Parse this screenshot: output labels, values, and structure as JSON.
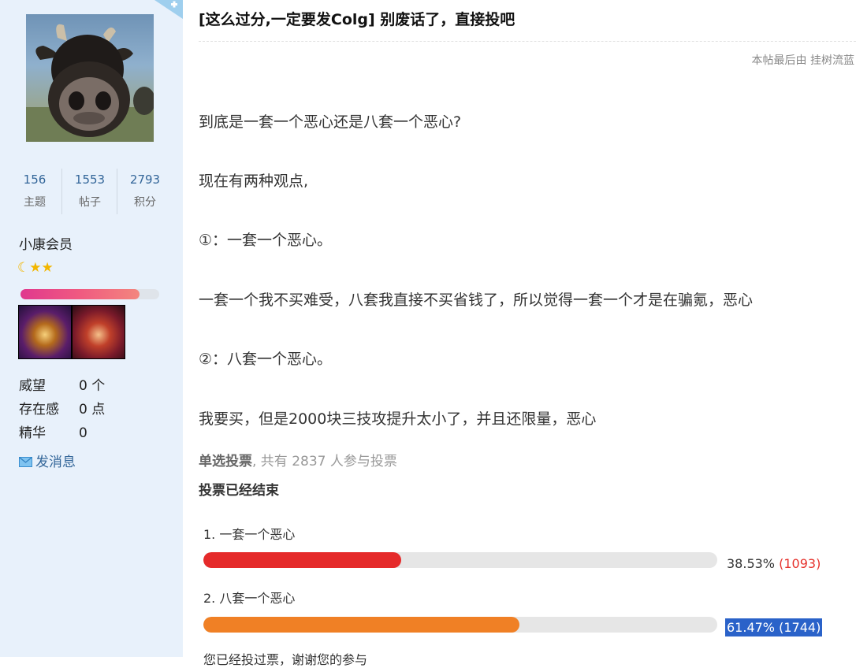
{
  "profile": {
    "stats": [
      {
        "value": "156",
        "label": "主题"
      },
      {
        "value": "1553",
        "label": "帖子"
      },
      {
        "value": "2793",
        "label": "积分"
      }
    ],
    "group": "小康会员",
    "rank_icons": [
      "moon-icon",
      "star-icon",
      "star-icon"
    ],
    "rank_progress": 0.86,
    "info": [
      {
        "key": "威望",
        "value": "0 个"
      },
      {
        "key": "存在感",
        "value": "0 点"
      },
      {
        "key": "精华",
        "value": "0"
      }
    ],
    "send_message": "发消息"
  },
  "post": {
    "title": "[这么过分,一定要发Colg] 别废话了，直接投吧",
    "last_edit": "本帖最后由 挂树流蓝",
    "paragraphs": [
      "到底是一套一个恶心还是八套一个恶心?",
      "现在有两种观点,",
      "①：一套一个恶心。",
      "一套一个我不买难受，八套我直接不买省钱了，所以觉得一套一个才是在骗氪，恶心",
      "②：八套一个恶心。",
      "我要买，但是2000块三技攻提升太小了，并且还限量，恶心"
    ]
  },
  "poll": {
    "type_label": "单选投票",
    "participants_text": ", 共有 2837 人参与投票",
    "status": "投票已经结束",
    "options": [
      {
        "label": "1.  一套一个恶心",
        "percent": "38.53%",
        "count": "(1093)",
        "fraction": 0.3853,
        "color": "#e52a2a"
      },
      {
        "label": "2.  八套一个恶心",
        "percent": "61.47%",
        "count": "(1744)",
        "fraction": 0.6147,
        "color": "#f08025"
      }
    ],
    "footer_partial": "您已经投过票，谢谢您的参与"
  }
}
